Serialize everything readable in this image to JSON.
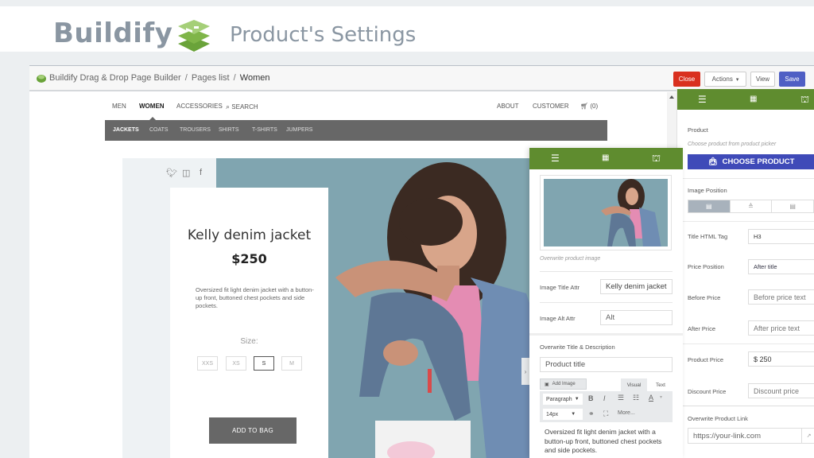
{
  "banner": {
    "brand": "Buildify",
    "title": "Product's Settings"
  },
  "topbar": {
    "breadcrumb": [
      "Buildify Drag & Drop Page Builder",
      "Pages list",
      "Women"
    ],
    "separator": "/",
    "buttons": {
      "close": "Close",
      "actions": "Actions",
      "actions_caret": "▾",
      "view": "View",
      "save": "Save"
    }
  },
  "site": {
    "nav_left": [
      "MEN",
      "WOMEN",
      "ACCESSORIES"
    ],
    "search": "SEARCH",
    "nav_right": [
      "ABOUT",
      "CUSTOMER"
    ],
    "cart": "(0)",
    "subnav": [
      "JACKETS",
      "COATS",
      "TROUSERS",
      "SHIRTS",
      "T-SHIRTS",
      "JUMPERS"
    ],
    "social": [
      "twitter",
      "instagram",
      "facebook"
    ],
    "product": {
      "title": "Kelly denim jacket",
      "price": "$250",
      "description": "Oversized fit light denim jacket with a button-up front, buttoned chest pockets and side pockets.",
      "size_label": "Size:",
      "sizes": [
        "XXS",
        "XS",
        "S",
        "M"
      ],
      "selected_size": "S",
      "add_to_bag": "ADD TO BAG"
    }
  },
  "right_panel": {
    "product_label": "Product",
    "product_hint": "Choose product from product picker",
    "choose_button": "CHOOSE PRODUCT",
    "image_position_label": "Image Position",
    "title_tag_label": "Title HTML Tag",
    "title_tag_value": "H3",
    "price_position_label": "Price Position",
    "price_position_value": "After title",
    "before_price_label": "Before Price",
    "before_price_placeholder": "Before price text",
    "after_price_label": "After Price",
    "after_price_placeholder": "After price text",
    "product_price_label": "Product Price",
    "product_price_value": "$ 250",
    "discount_label": "Discount Price",
    "discount_placeholder": "Discount price",
    "link_label": "Overwrite Product Link",
    "link_placeholder": "https://your-link.com"
  },
  "mid_panel": {
    "image_hint": "Overwrite product image",
    "image_title_label": "Image Title Attr",
    "image_title_value": "Kelly denim jacket",
    "image_alt_label": "Image Alt Attr",
    "image_alt_placeholder": "Alt",
    "overwrite_label": "Overwrite Title & Description",
    "title_placeholder": "Product title",
    "add_image": "Add Image",
    "tab_visual": "Visual",
    "tab_text": "Text",
    "format_select": "Paragraph",
    "size_select": "14px",
    "more": "More...",
    "editor_text": "Oversized fit light denim jacket with a button-up front, buttoned chest pockets and side pockets."
  },
  "colors": {
    "brand_green": "#5f8c2f",
    "close_red": "#d9301f",
    "save_blue": "#4f5fc4",
    "choose_blue": "#3f4ab8",
    "hero_bg": "#80a5b0"
  }
}
